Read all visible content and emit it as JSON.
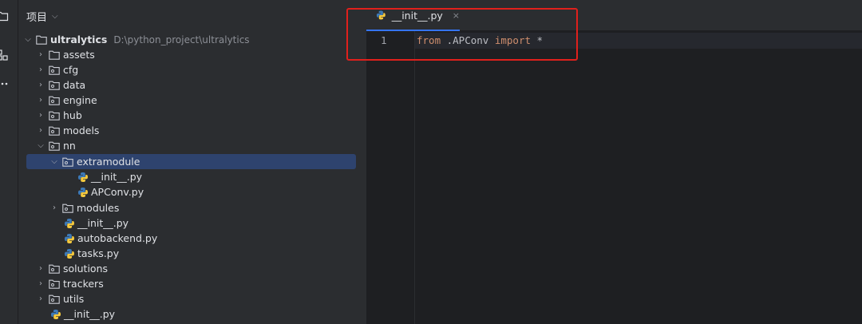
{
  "project_panel": {
    "title": "项目",
    "tree": [
      {
        "label": "ultralytics",
        "path": "D:\\python_project\\ultralytics"
      },
      {
        "label": "assets"
      },
      {
        "label": "cfg"
      },
      {
        "label": "data"
      },
      {
        "label": "engine"
      },
      {
        "label": "hub"
      },
      {
        "label": "models"
      },
      {
        "label": "nn"
      },
      {
        "label": "extramodule"
      },
      {
        "label": "__init__.py"
      },
      {
        "label": "APConv.py"
      },
      {
        "label": "modules"
      },
      {
        "label": "__init__.py"
      },
      {
        "label": "autobackend.py"
      },
      {
        "label": "tasks.py"
      },
      {
        "label": "solutions"
      },
      {
        "label": "trackers"
      },
      {
        "label": "utils"
      },
      {
        "label": "__init__.py"
      }
    ]
  },
  "editor": {
    "tab_label": "__init__.py",
    "tab_close": "×",
    "line_number": "1",
    "code": {
      "kw1": "from",
      "module": " .APConv ",
      "kw2": "import",
      "rest": " *"
    }
  },
  "colors": {
    "accent": "#3574f0",
    "highlight_box": "#e0201c",
    "keyword": "#cf8e6d"
  }
}
